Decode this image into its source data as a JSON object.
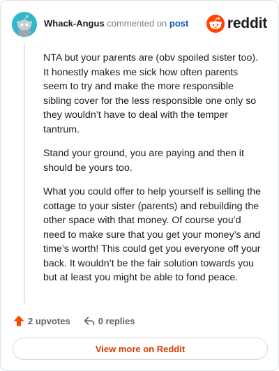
{
  "comment": {
    "author": "Whack-Angus",
    "action_text": "commented on",
    "post_link_text": "post",
    "paragraphs": [
      "NTA but your parents are (obv spoiled sister too). It honestly makes me sick how often parents seem to try and make the more responsible sibling cover for the less responsible one only so they wouldn’t have to deal with the temper tantrum.",
      "Stand your ground, you are paying and then it should be yours too.",
      "What you could offer to help yourself is selling the cottage to your sister (parents) and rebuilding the other space with that money. Of course you’d need to make sure that you get your money’s and time’s worth! This could get you everyone off your back. It wouldn’t be the fair solution towards you but at least you might be able to fond peace."
    ],
    "upvotes_text": "2 upvotes",
    "replies_text": "0 replies"
  },
  "brand": {
    "wordmark": "reddit",
    "logo_icon": "reddit-snoo-icon",
    "accent_color": "#ff4500"
  },
  "cta": {
    "label": "View more on Reddit"
  }
}
